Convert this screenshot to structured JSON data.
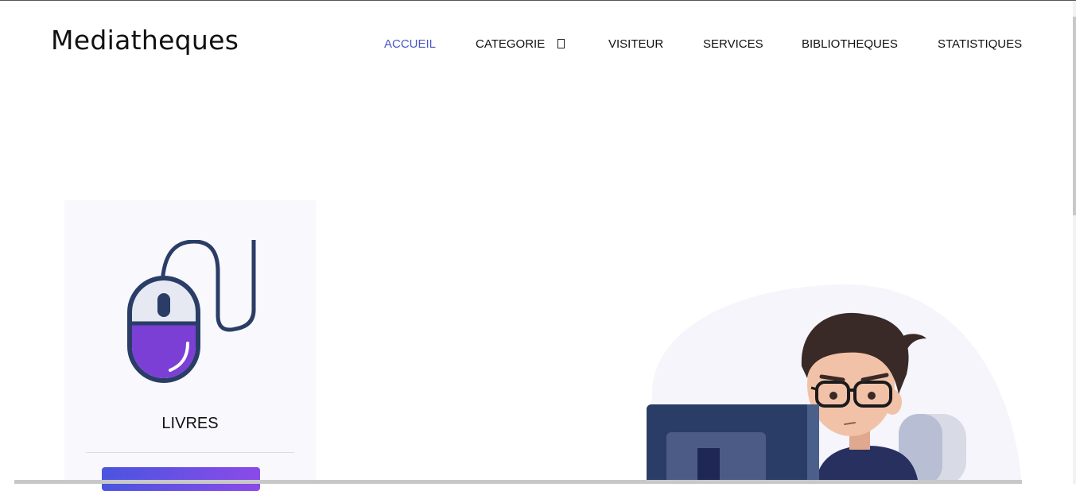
{
  "header": {
    "brand": "Mediatheques"
  },
  "nav": {
    "items": [
      {
        "label": "ACCUEIL",
        "active": true
      },
      {
        "label": "CATEGORIE",
        "has_dropdown": true
      },
      {
        "label": "VISITEUR"
      },
      {
        "label": "SERVICES"
      },
      {
        "label": "BIBLIOTHEQUES"
      },
      {
        "label": "STATISTIQUES"
      }
    ]
  },
  "card": {
    "title": "LIVRES",
    "icon": "mouse-icon"
  },
  "hero": {
    "illustration": "person-at-computer-illustration"
  },
  "colors": {
    "accent": "#4a56c8",
    "card_bg": "#f8f8fd",
    "button_gradient_start": "#4a55e0",
    "button_gradient_end": "#8b4ae8",
    "mouse_purple": "#7b3fd6",
    "dark_navy": "#2a3d66"
  }
}
